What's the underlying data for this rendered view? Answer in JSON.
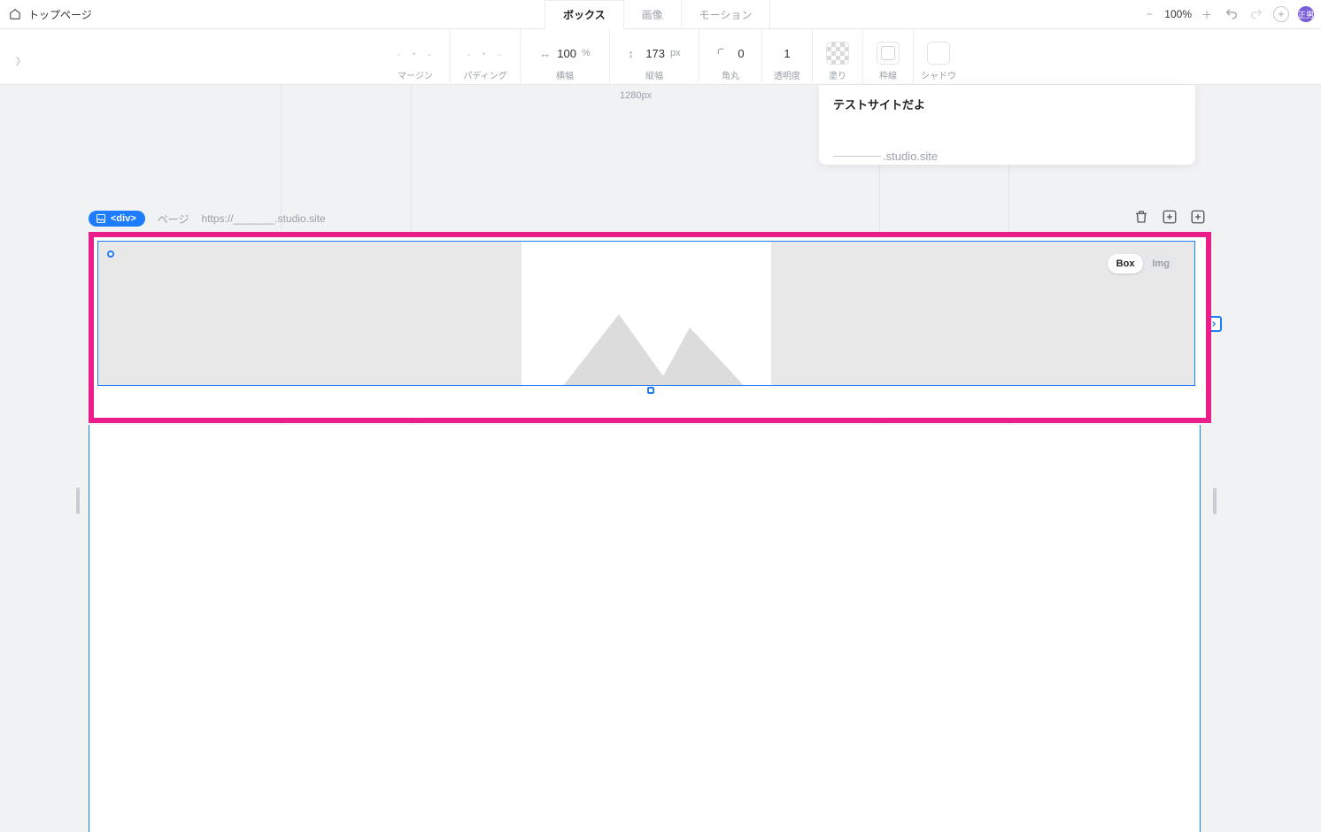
{
  "topbar": {
    "page_name": "トップページ",
    "tabs": {
      "box": "ボックス",
      "image": "画像",
      "motion": "モーション"
    },
    "zoom": "100%",
    "avatar": "正男"
  },
  "props": {
    "margin": {
      "label": "マージン",
      "value": "- ・ -"
    },
    "padding": {
      "label": "パディング",
      "value": "- ・ -"
    },
    "width": {
      "label": "横幅",
      "value": "100",
      "unit": "%"
    },
    "height": {
      "label": "縦幅",
      "value": "173",
      "unit": "px"
    },
    "corner": {
      "label": "角丸",
      "value": "0"
    },
    "opacity": {
      "label": "透明度",
      "value": "1"
    },
    "fill": {
      "label": "塗り"
    },
    "border": {
      "label": "枠線"
    },
    "shadow": {
      "label": "シャドウ"
    }
  },
  "canvas": {
    "ruler": "1280px",
    "site_title": "テストサイトだよ",
    "site_domain": ".studio.site",
    "tag": "<div>",
    "page_label_suffix": "ページ",
    "url": "https://_______.studio.site",
    "toggle": {
      "box": "Box",
      "img": "Img"
    }
  }
}
